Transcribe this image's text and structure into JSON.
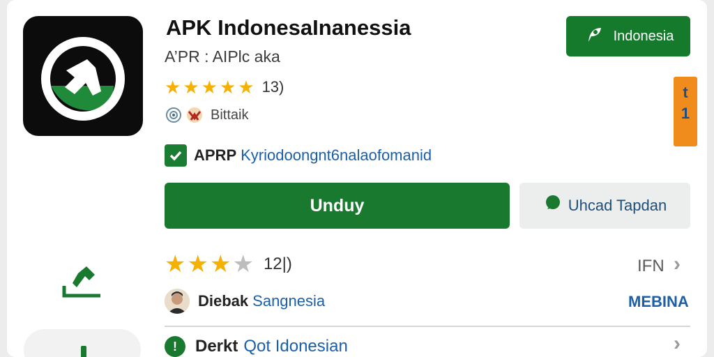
{
  "app": {
    "title": "APK IndonesaInanessia",
    "subtitle": "A’PR : AIPlc aka",
    "rating_count": "13)",
    "developer": "Bittaik",
    "verified_label": "APRP",
    "verified_link": "Kyriodoongnt6nalaofomanid",
    "icon": "app-logo-icon",
    "rating_stars": 5
  },
  "header_actions": {
    "region_label": "Indonesia",
    "region_icon": "flag-icon",
    "side_badge_top": "t",
    "side_badge_bottom": "1"
  },
  "buttons": {
    "download_label": "Unduy",
    "secondary_label": "Uhcad Tapdan",
    "secondary_icon": "chat-icon"
  },
  "review": {
    "rating_stars": 3,
    "rating_count": "12|)",
    "right_label": "IFN",
    "download_icon": "download-icon"
  },
  "publisher": {
    "bold": "Diebak",
    "link": "Sangnesia",
    "right": "MEBINA"
  },
  "info": {
    "icon_text": "!",
    "bold": "Derkt",
    "link": "Qot Idonesian"
  },
  "colors": {
    "primary_green": "#197a2f",
    "badge_orange": "#f08c1c",
    "link_blue": "#1b5fa8",
    "star_gold": "#f6b100"
  }
}
